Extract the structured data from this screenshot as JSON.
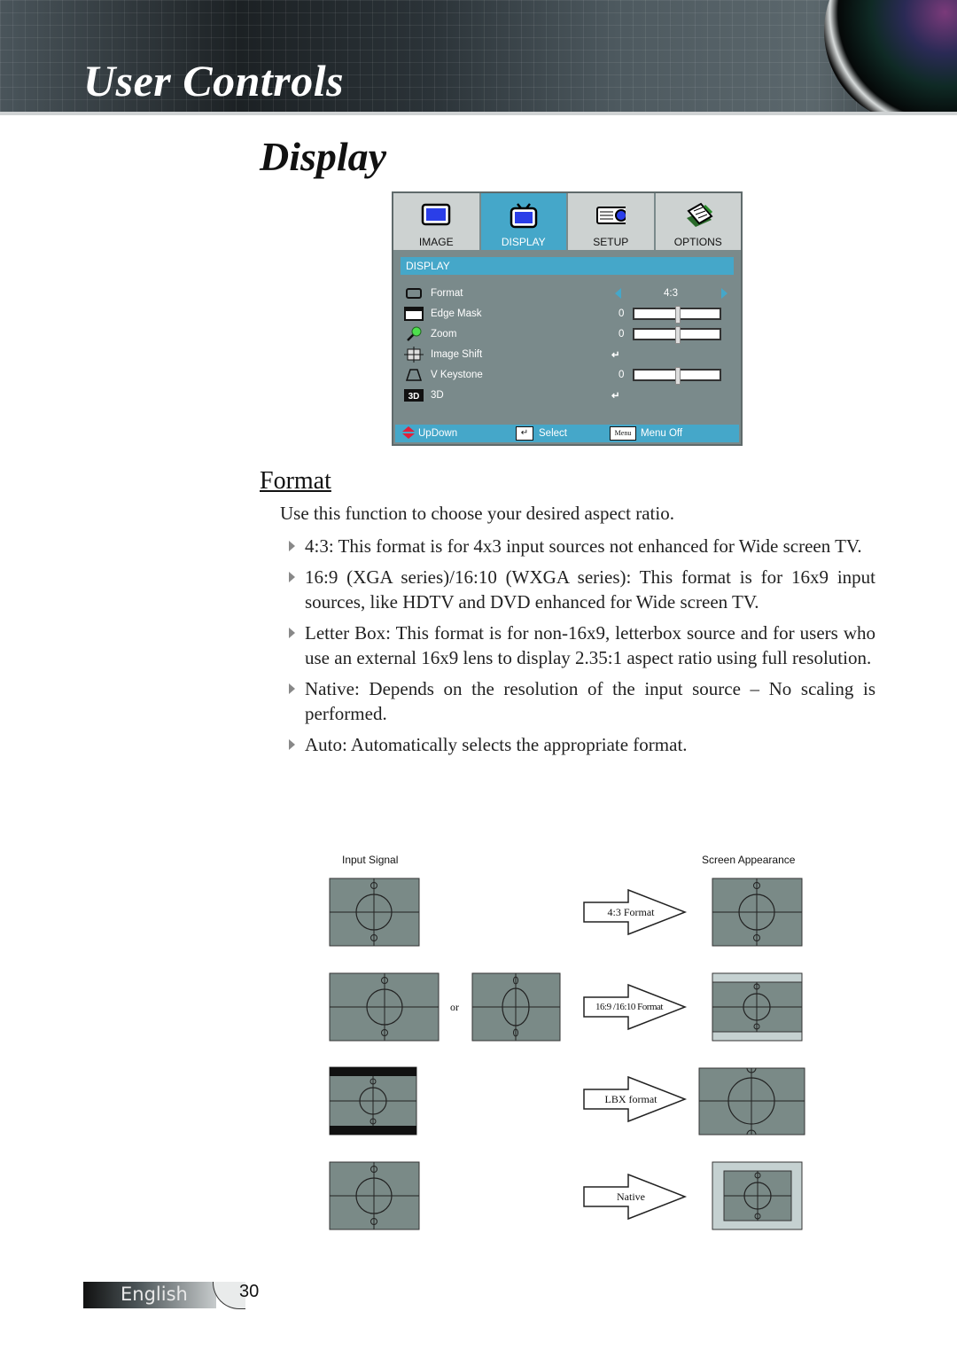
{
  "header": {
    "title": "User Controls"
  },
  "section_title": "Display",
  "osd": {
    "tabs": [
      {
        "label": "IMAGE",
        "icon": "monitor-icon",
        "active": false
      },
      {
        "label": "DISPLAY",
        "icon": "tv-icon",
        "active": true
      },
      {
        "label": "SETUP",
        "icon": "projector-icon",
        "active": false
      },
      {
        "label": "OPTIONS",
        "icon": "notepad-icon",
        "active": false
      }
    ],
    "heading": "DISPLAY",
    "rows": [
      {
        "label": "Format",
        "icon": "format-icon",
        "value": "4:3",
        "type": "selector"
      },
      {
        "label": "Edge Mask",
        "icon": "edge-mask-icon",
        "value": "0",
        "type": "slider",
        "level": 0.5
      },
      {
        "label": "Zoom",
        "icon": "zoom-icon",
        "value": "0",
        "type": "slider",
        "level": 0.5
      },
      {
        "label": "Image Shift",
        "icon": "image-shift-icon",
        "value": "↵",
        "type": "enter"
      },
      {
        "label": "V Keystone",
        "icon": "keystone-icon",
        "value": "0",
        "type": "slider",
        "level": 0.5
      },
      {
        "label": "3D",
        "icon": "3d-icon",
        "value": "↵",
        "type": "enter"
      }
    ],
    "footer": {
      "updown": "UpDown",
      "select": "Select",
      "menu_key": "Menu",
      "menu_off": "Menu Off"
    }
  },
  "format": {
    "title": "Format",
    "intro": "Use this function to choose your desired aspect ratio.",
    "bullets": [
      "4:3: This format is for 4x3 input sources not enhanced for Wide screen TV.",
      "16:9 (XGA series)/16:10 (WXGA series): This format is for 16x9 input sources, like HDTV and DVD enhanced for Wide screen TV.",
      "Letter Box: This format is for non-16x9, letterbox source and for users who use an external 16x9 lens to display 2.35:1 aspect ratio using full resolution.",
      "Native: Depends on the resolution of the input source – No scaling is performed.",
      "Auto: Automatically selects the appropriate format."
    ]
  },
  "diagram": {
    "input_label": "Input Signal",
    "output_label": "Screen Appearance",
    "or_label": "or",
    "arrows": [
      "4:3 Format",
      "16:9 /16:10 Format",
      "LBX format",
      "Native"
    ]
  },
  "footer": {
    "language": "English",
    "page": "30"
  }
}
